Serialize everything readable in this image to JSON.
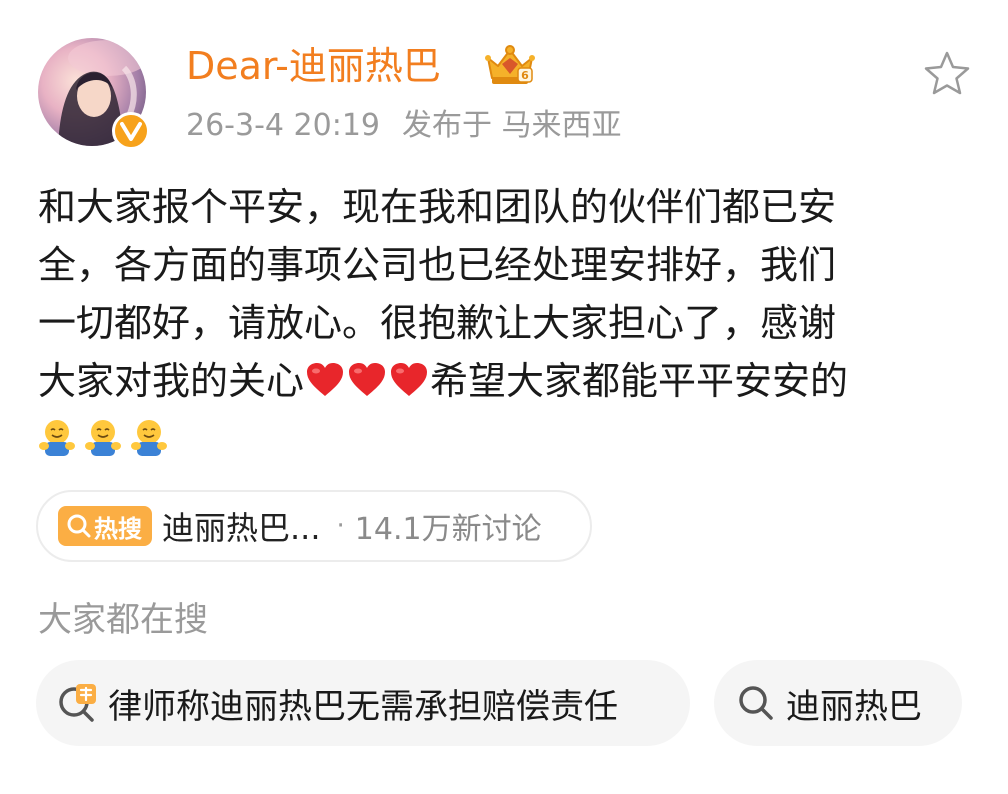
{
  "post": {
    "author": "Dear-迪丽热巴",
    "timestamp": "26-3-4 20:19",
    "location": "发布于 马来西亚",
    "body_lines": [
      "和大家报个平安，现在我和团队的伙伴们都已安",
      "全，各方面的事项公司也已经处理安排好，我们",
      "一切都好，请放心。很抱歉让大家担心了，感谢"
    ],
    "line4_before": "大家对我的关心",
    "line4_after": "希望大家都能平平安安的",
    "line5_emoji": [
      "hug-emoji",
      "hug-emoji",
      "hug-emoji"
    ],
    "line4_emoji": [
      "red-heart-emoji",
      "red-heart-emoji",
      "red-heart-emoji"
    ]
  },
  "trending": {
    "tag": "热搜",
    "topic": "迪丽热巴...",
    "separator": "·",
    "count": "14.1万新讨论"
  },
  "related": {
    "title": "大家都在搜",
    "chips": [
      {
        "label": "律师称迪丽热巴无需承担赔偿责任",
        "icon": "hot-search-icon"
      },
      {
        "label": "迪丽热巴",
        "icon": "search-icon"
      }
    ]
  },
  "colors": {
    "username": "#f27e1f",
    "meta": "#9a9a9a",
    "hot_tag": "#fbae44",
    "verified_badge": "#f7a21b"
  }
}
